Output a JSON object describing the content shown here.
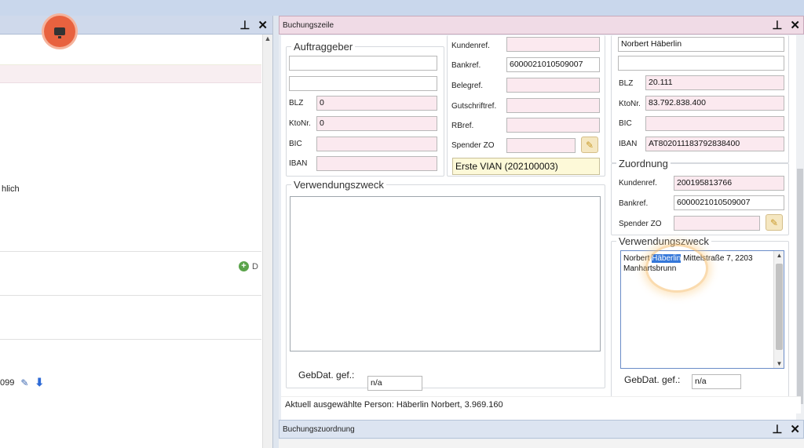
{
  "left": {
    "partial_text": "hlich",
    "add_label": "D",
    "row_value": "099"
  },
  "buchungszeile": {
    "title": "Buchungszeile",
    "auftraggeber": {
      "title": "Auftraggeber",
      "line1": "",
      "line2": "",
      "blz_label": "BLZ",
      "blz": "0",
      "kto_label": "KtoNr.",
      "kto": "0",
      "bic_label": "BIC",
      "bic": "",
      "iban_label": "IBAN",
      "iban": ""
    },
    "refs": {
      "kundenref_label": "Kundenref.",
      "kundenref": "",
      "bankref_label": "Bankref.",
      "bankref": "6000021010509007",
      "belegref_label": "Belegref.",
      "belegref": "",
      "gutschrift_label": "Gutschriftref.",
      "gutschrift": "",
      "rbref_label": "RBref.",
      "rbref": "",
      "spender_label": "Spender ZO",
      "spender": "",
      "vian": "Erste VIAN (202100003)"
    },
    "verwendungszweck": {
      "title": "Verwendungszweck",
      "text": "",
      "gebdat_label": "GebDat. gef.:",
      "gebdat": "n/a"
    },
    "person": {
      "name": "Norbert Häberlin",
      "line2": "",
      "blz_label": "BLZ",
      "blz": "20.111",
      "kto_label": "KtoNr.",
      "kto": "83.792.838.400",
      "bic_label": "BIC",
      "bic": "",
      "iban_label": "IBAN",
      "iban": "AT802011183792838400"
    },
    "zuordnung": {
      "title": "Zuordnung",
      "kundenref_label": "Kundenref.",
      "kundenref": "200195813766",
      "bankref_label": "Bankref.",
      "bankref": "6000021010509007",
      "spender_label": "Spender ZO",
      "spender": ""
    },
    "verwendungszweck2": {
      "title": "Verwendungszweck",
      "pre": "Norbert ",
      "selected": "Häberlin",
      "post": " Mittelstraße 7, 2203 Manhartsbrunn",
      "gebdat_label": "GebDat. gef.:",
      "gebdat": "n/a"
    },
    "status": "Aktuell ausgewählte Person: Häberlin Norbert, 3.969.160"
  },
  "buchungszuordnung": {
    "title": "Buchungszuordnung"
  },
  "icons": {
    "pin": "pin-icon",
    "close": "close-icon"
  }
}
